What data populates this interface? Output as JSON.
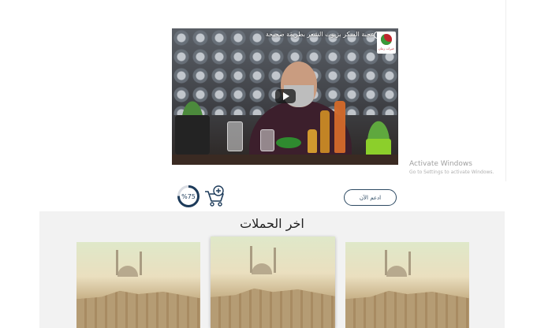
{
  "video": {
    "title": "عجبة السكر بزيوت الشعر بطريقة صحيحة",
    "channel_logo_text": "خيرات زمان",
    "play_icon": "play-icon",
    "clock_icon": "clock-icon"
  },
  "watermark": {
    "title": "Activate Windows",
    "subtitle": "Go to Settings to activate Windows."
  },
  "campaign_progress": {
    "percent": 75,
    "label": "%75",
    "cart_icon": "add-to-cart-icon"
  },
  "actions": {
    "support_now_label": "ادعم الآن"
  },
  "campaigns": {
    "title": "اخر الحملات",
    "cards": [
      {
        "image": "citadel-photo"
      },
      {
        "image": "citadel-photo"
      },
      {
        "image": "citadel-photo"
      }
    ]
  },
  "colors": {
    "accent": "#2d4a63",
    "progress_track": "#dadde3",
    "progress_fill": "#1d3b5a",
    "section_bg": "#f2f2f2"
  }
}
